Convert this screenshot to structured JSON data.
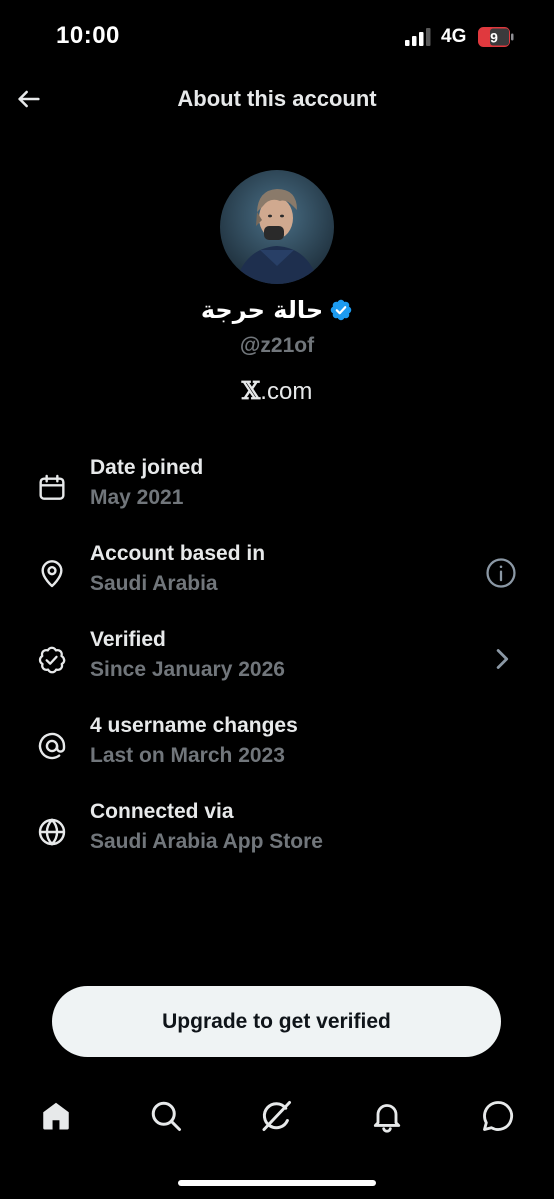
{
  "status_bar": {
    "time": "10:00",
    "network": "4G",
    "battery_level": "9",
    "icons": [
      "signal-icon",
      "battery-icon"
    ]
  },
  "header": {
    "title": "About this account",
    "back_icon": "arrow-left-icon"
  },
  "profile": {
    "display_name": "حالة حرجة",
    "handle": "@z21of",
    "site_letter": "𝕏",
    "site_rest": ".com",
    "verified": true,
    "badge_color": "#1d9bf0"
  },
  "info_items": [
    {
      "icon": "calendar-icon",
      "title": "Date joined",
      "subtitle": "May 2021",
      "action": null
    },
    {
      "icon": "location-pin-icon",
      "title": "Account based in",
      "subtitle": "Saudi Arabia",
      "action": "info-icon"
    },
    {
      "icon": "verified-badge-outline-icon",
      "title": "Verified",
      "subtitle": "Since January 2026",
      "action": "chevron-right-icon"
    },
    {
      "icon": "at-sign-icon",
      "title": "4 username changes",
      "subtitle": "Last on March 2023",
      "action": null
    },
    {
      "icon": "globe-icon",
      "title": "Connected via",
      "subtitle": "Saudi Arabia App Store",
      "action": null
    }
  ],
  "cta": {
    "label": "Upgrade to get verified"
  },
  "bottom_nav": [
    "home-icon",
    "search-icon",
    "grok-icon",
    "notifications-bell-icon",
    "messages-icon"
  ],
  "colors": {
    "background": "#000000",
    "primary_text": "#e7e9ea",
    "secondary_text": "#71767b",
    "button_bg": "#eff3f4",
    "battery_red": "#e0393e"
  }
}
